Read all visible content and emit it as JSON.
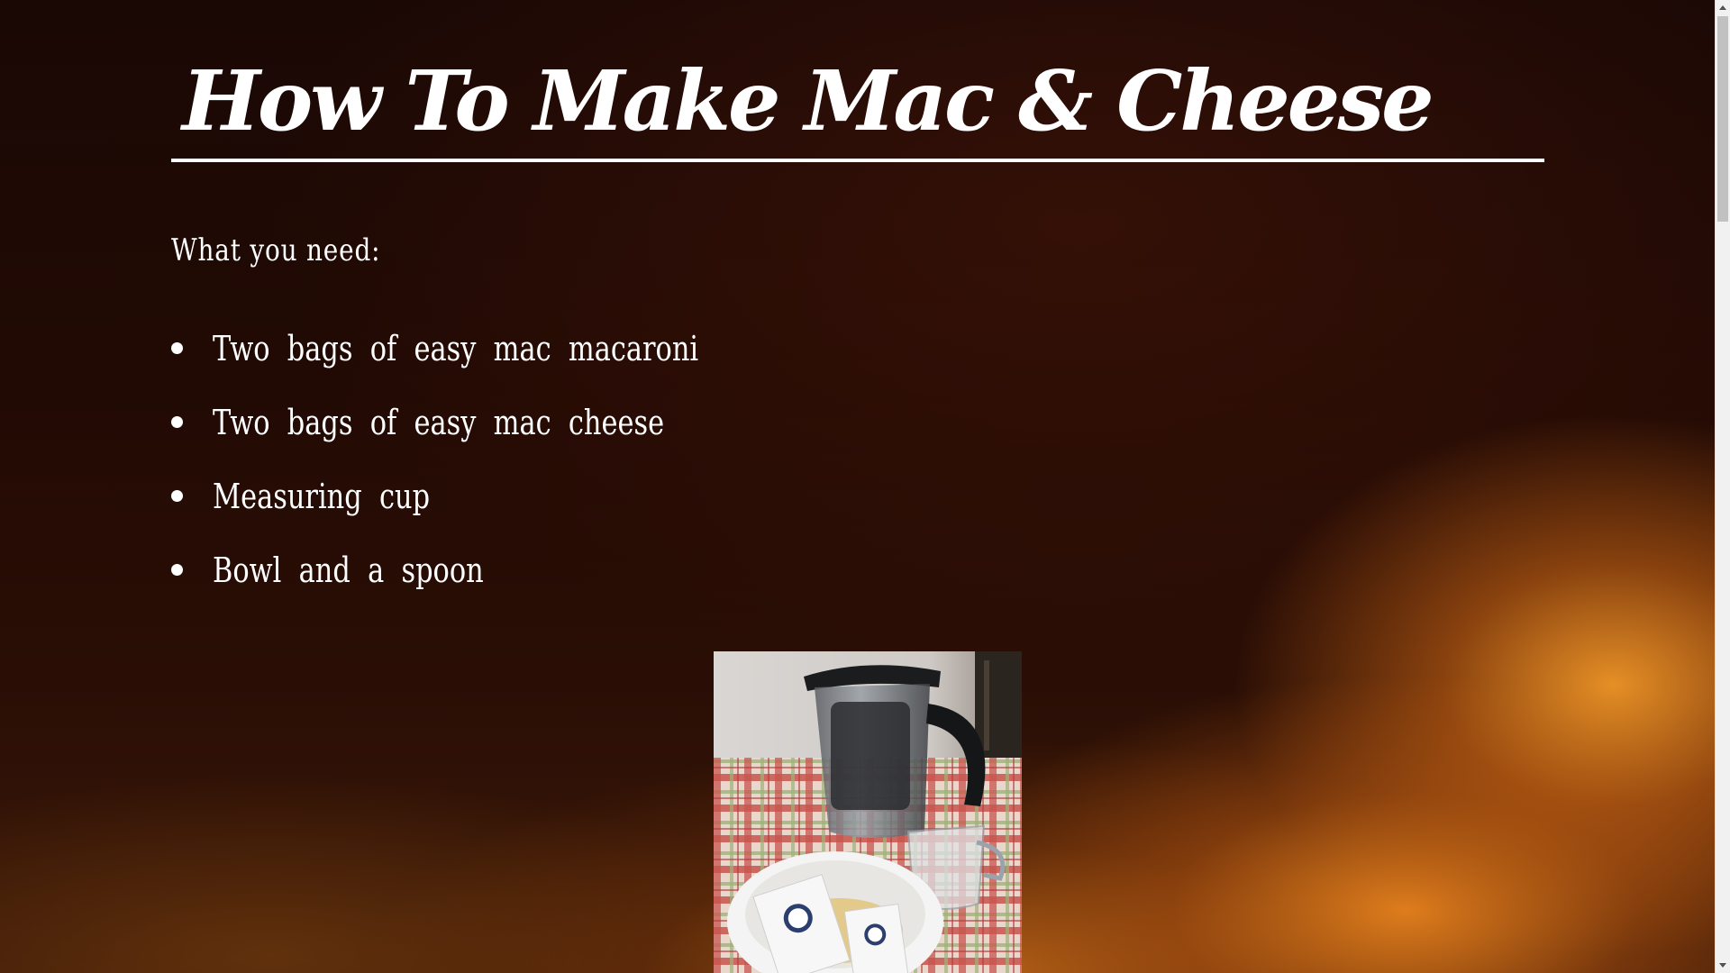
{
  "page": {
    "title": "How To Make Mac & Cheese",
    "section_heading": "What you need:"
  },
  "ingredients": [
    {
      "label": "Two bags of easy mac macaroni"
    },
    {
      "label": "Two bags of easy mac cheese"
    },
    {
      "label": "Measuring cup"
    },
    {
      "label": "Bowl and a spoon"
    }
  ],
  "photo": {
    "icon": "ingredients-photo",
    "caption": ""
  },
  "colors": {
    "text": "#ffffff",
    "background_dark": "#1a0805",
    "background_glow": "#e08a20",
    "tablecloth": "#c8554f"
  },
  "scrollbar": {
    "up_icon": "chevron-up-icon",
    "down_icon": "chevron-down-icon"
  }
}
